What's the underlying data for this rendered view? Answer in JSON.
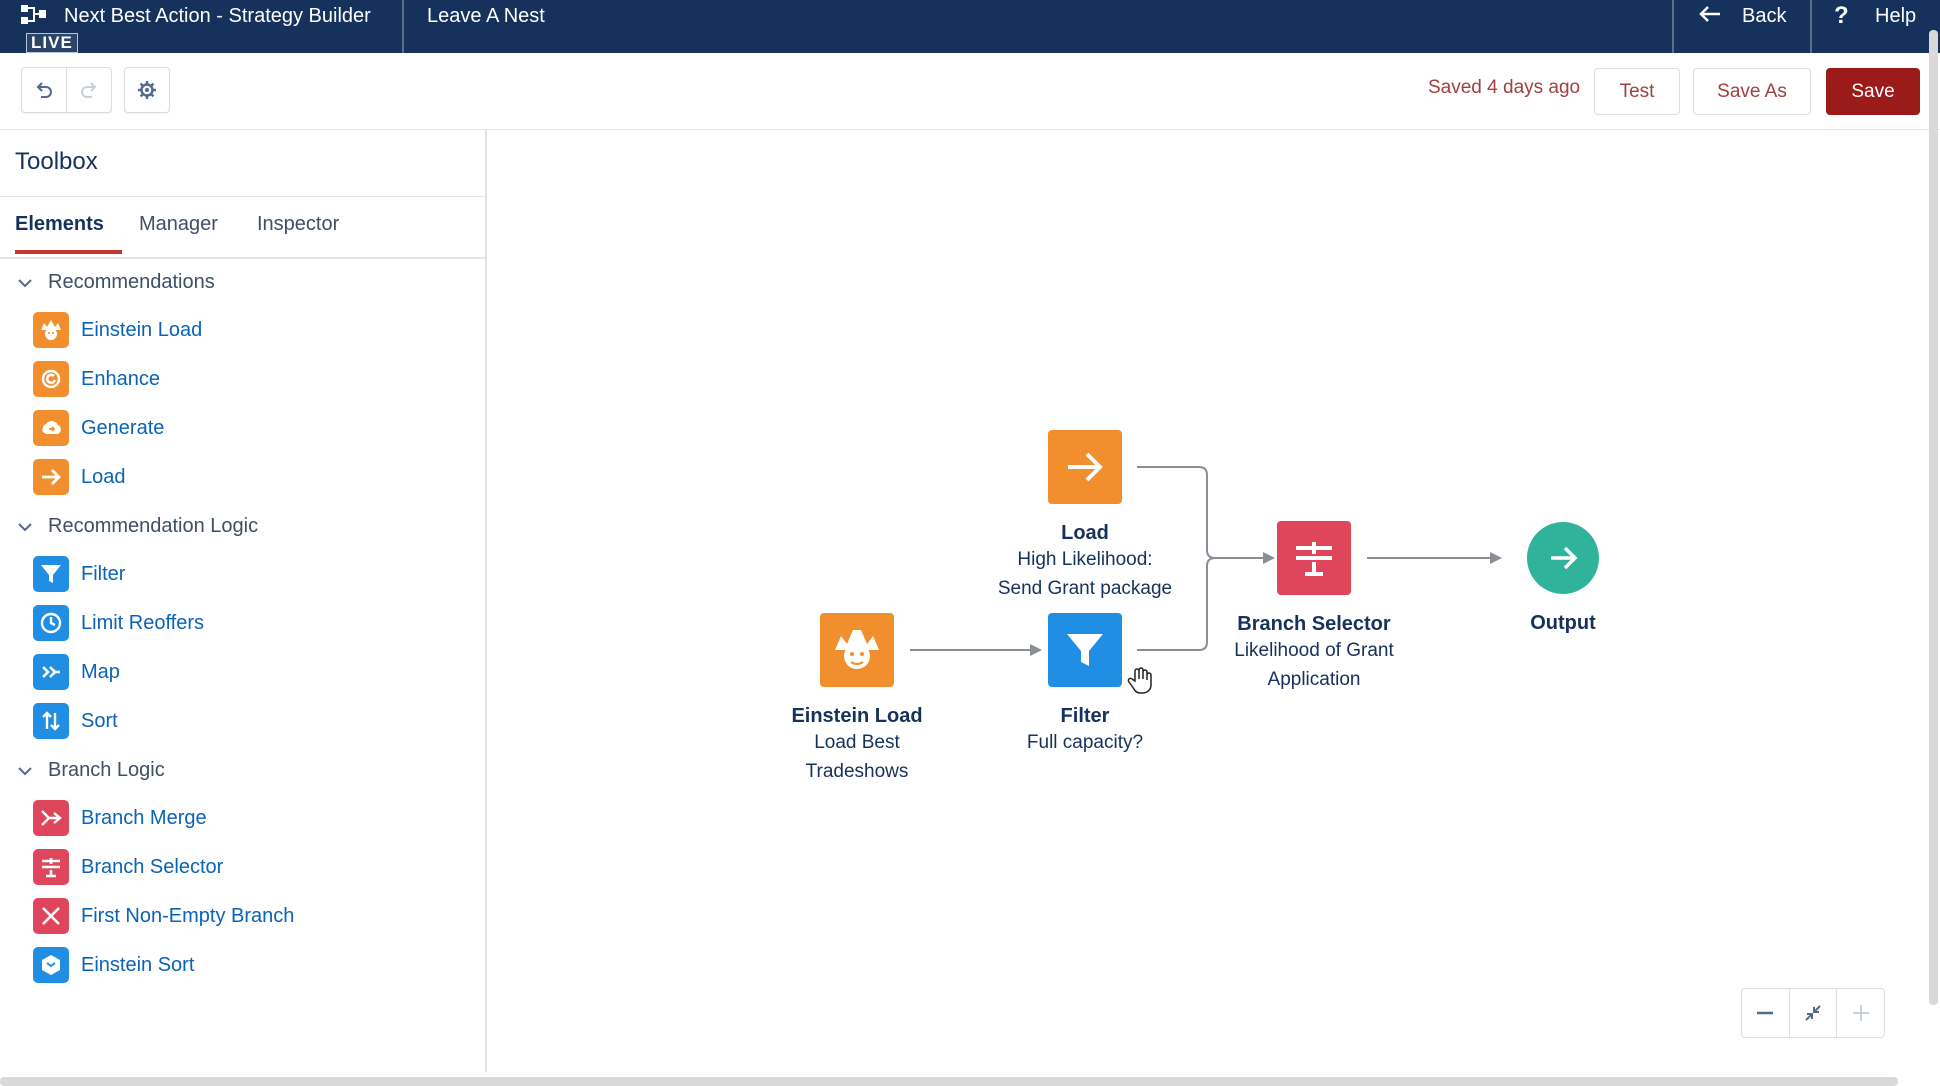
{
  "header": {
    "app_title": "Next Best Action - Strategy Builder",
    "live_badge": "LIVE",
    "strategy_name": "Leave A Nest",
    "back_label": "Back",
    "help_label": "Help",
    "help_icon_glyph": "?"
  },
  "toolbar": {
    "saved_status": "Saved 4 days ago",
    "test_label": "Test",
    "save_as_label": "Save As",
    "save_label": "Save"
  },
  "toolbox": {
    "title": "Toolbox",
    "tabs": [
      {
        "label": "Elements",
        "active": true
      },
      {
        "label": "Manager",
        "active": false
      },
      {
        "label": "Inspector",
        "active": false
      }
    ],
    "groups": [
      {
        "label": "Recommendations",
        "items": [
          {
            "label": "Einstein Load",
            "icon": "einstein-icon",
            "color": "#f18e2e"
          },
          {
            "label": "Enhance",
            "icon": "enhance-icon",
            "color": "#f18e2e"
          },
          {
            "label": "Generate",
            "icon": "generate-icon",
            "color": "#f18e2e"
          },
          {
            "label": "Load",
            "icon": "arrow-right-icon",
            "color": "#f18e2e"
          }
        ]
      },
      {
        "label": "Recommendation Logic",
        "items": [
          {
            "label": "Filter",
            "icon": "filter-icon",
            "color": "#1f8ee3"
          },
          {
            "label": "Limit Reoffers",
            "icon": "clock-icon",
            "color": "#1f8ee3"
          },
          {
            "label": "Map",
            "icon": "map-icon",
            "color": "#1f8ee3"
          },
          {
            "label": "Sort",
            "icon": "sort-icon",
            "color": "#1f8ee3"
          }
        ]
      },
      {
        "label": "Branch Logic",
        "items": [
          {
            "label": "Branch Merge",
            "icon": "branch-merge-icon",
            "color": "#e0465b"
          },
          {
            "label": "Branch Selector",
            "icon": "branch-selector-icon",
            "color": "#e0465b"
          },
          {
            "label": "First Non-Empty Branch",
            "icon": "first-non-empty-branch-icon",
            "color": "#e0465b"
          },
          {
            "label": "Einstein Sort",
            "icon": "einstein-sort-icon",
            "color": "#1f8ee3"
          }
        ]
      }
    ]
  },
  "canvas": {
    "nodes": {
      "load": {
        "title": "Load",
        "desc1": "High Likelihood:",
        "desc2": "Send Grant package"
      },
      "einstein_load": {
        "title": "Einstein Load",
        "desc1": "Load Best",
        "desc2": "Tradeshows"
      },
      "filter": {
        "title": "Filter",
        "desc1": "Full capacity?"
      },
      "branch_selector": {
        "title": "Branch Selector",
        "desc1": "Likelihood of Grant",
        "desc2": "Application"
      },
      "output": {
        "title": "Output"
      }
    },
    "zoom_controls": [
      "zoom-out-icon",
      "fit-icon",
      "zoom-in-icon"
    ]
  },
  "colors": {
    "header_bg": "#16325c",
    "save_bg": "#9b1a1a",
    "accent_text": "#a23f3f",
    "link": "#0a63b8",
    "orange": "#f18e2e",
    "blue": "#1f8ee3",
    "red": "#e0465b",
    "teal": "#2fb39b"
  }
}
